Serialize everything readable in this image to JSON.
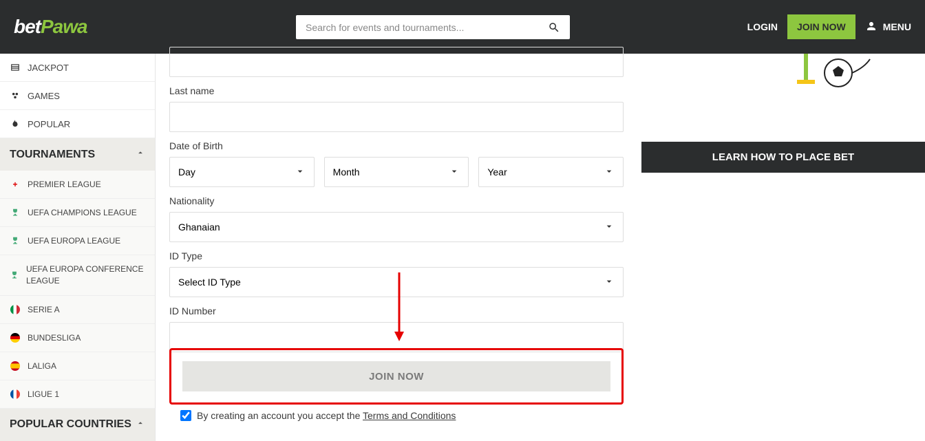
{
  "header": {
    "logo_part1": "bet",
    "logo_part2": "Pawa",
    "search_placeholder": "Search for events and tournaments...",
    "login_label": "LOGIN",
    "join_label": "JOIN NOW",
    "menu_label": "MENU"
  },
  "sidebar": {
    "top_items": [
      {
        "label": "JACKPOT",
        "icon": "jackpot-icon"
      },
      {
        "label": "GAMES",
        "icon": "games-icon"
      },
      {
        "label": "POPULAR",
        "icon": "popular-icon"
      }
    ],
    "section_tournaments": "TOURNAMENTS",
    "tournaments": [
      {
        "label": "PREMIER LEAGUE",
        "icon": "plus-red"
      },
      {
        "label": "UEFA CHAMPIONS LEAGUE",
        "icon": "trophy-blue"
      },
      {
        "label": "UEFA EUROPA LEAGUE",
        "icon": "trophy-orange"
      },
      {
        "label": "UEFA EUROPA CONFERENCE LEAGUE",
        "icon": "trophy-green"
      },
      {
        "label": "SERIE A",
        "icon": "flag-it"
      },
      {
        "label": "BUNDESLIGA",
        "icon": "flag-de"
      },
      {
        "label": "LALIGA",
        "icon": "flag-es"
      },
      {
        "label": "LIGUE 1",
        "icon": "flag-fr"
      }
    ],
    "section_popular_countries": "POPULAR COUNTRIES"
  },
  "form": {
    "last_name_label": "Last name",
    "dob_label": "Date of Birth",
    "dob_day": "Day",
    "dob_month": "Month",
    "dob_year": "Year",
    "nationality_label": "Nationality",
    "nationality_value": "Ghanaian",
    "id_type_label": "ID Type",
    "id_type_value": "Select ID Type",
    "id_number_label": "ID Number",
    "submit_label": "JOIN NOW",
    "terms_prefix": "By creating an account you accept the ",
    "terms_link": "Terms and Conditions"
  },
  "right": {
    "banner_label": "LEARN HOW TO PLACE BET"
  }
}
